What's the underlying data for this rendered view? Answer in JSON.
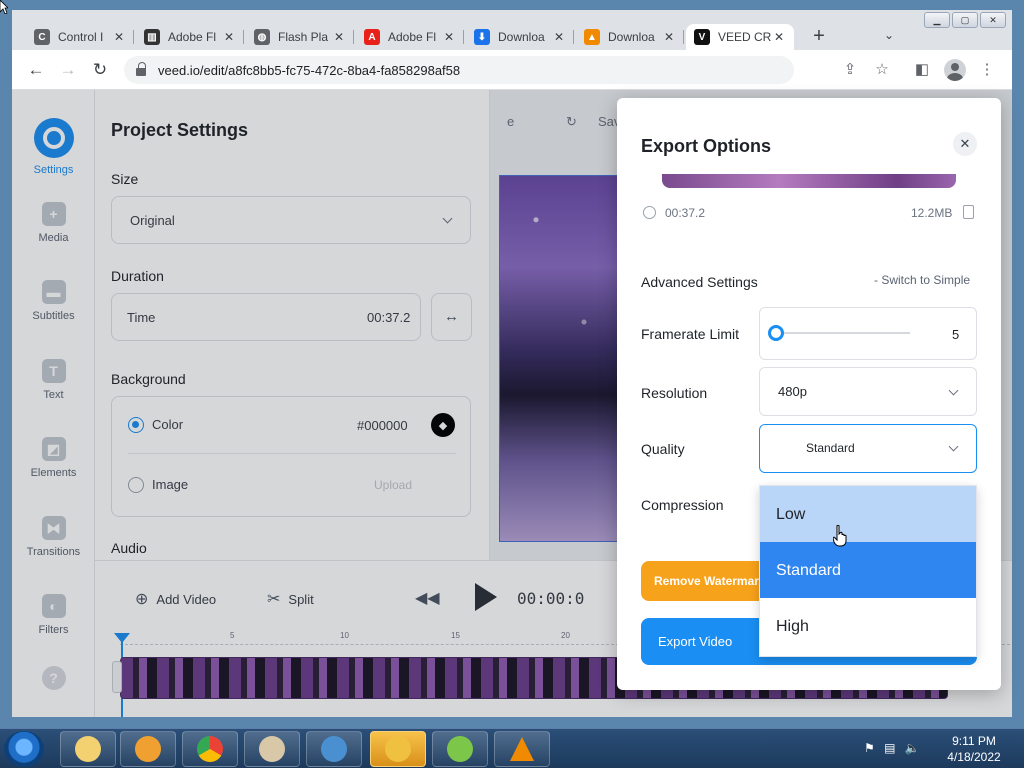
{
  "browser": {
    "tabs": [
      {
        "title": "Control I",
        "favicon": "C",
        "favicon_bg": "#5f6368",
        "favicon_name": "control-panel-icon"
      },
      {
        "title": "Adobe Fl",
        "favicon": "▥",
        "favicon_bg": "#333333",
        "favicon_name": "adobe-icon"
      },
      {
        "title": "Flash Pla",
        "favicon": "◍",
        "favicon_bg": "#5f6368",
        "favicon_name": "globe-icon"
      },
      {
        "title": "Adobe Fl",
        "favicon": "A",
        "favicon_bg": "#e8211b",
        "favicon_name": "adobe-red-icon"
      },
      {
        "title": "Downloa",
        "favicon": "⬇",
        "favicon_bg": "#1a73e8",
        "favicon_name": "download-icon"
      },
      {
        "title": "Downloa",
        "favicon": "▲",
        "favicon_bg": "#f08a00",
        "favicon_name": "vlc-icon"
      },
      {
        "title": "VEED CR",
        "favicon": "V",
        "favicon_bg": "#111111",
        "favicon_name": "veed-icon",
        "active": true
      }
    ],
    "url": "veed.io/edit/a8fc8bb5-fc75-472c-8ba4-fa858298af58"
  },
  "nav": {
    "items": [
      {
        "label": "Settings",
        "active": true
      },
      {
        "label": "Media",
        "glyph": "+"
      },
      {
        "label": "Subtitles",
        "glyph": "▬"
      },
      {
        "label": "Text",
        "glyph": "T"
      },
      {
        "label": "Elements",
        "glyph": "◩"
      },
      {
        "label": "Transitions",
        "glyph": "⧓"
      },
      {
        "label": "Filters",
        "glyph": "◐"
      },
      {
        "label": "",
        "glyph": "?"
      }
    ]
  },
  "project_settings": {
    "title": "Project Settings",
    "size_label": "Size",
    "size_value": "Original",
    "duration_label": "Duration",
    "time_label": "Time",
    "time_value": "00:37.2",
    "background_label": "Background",
    "color_label": "Color",
    "color_value": "#000000",
    "image_label": "Image",
    "upload_label": "Upload",
    "audio_label": "Audio"
  },
  "preview": {
    "left_text": "e",
    "save_text": "Sav"
  },
  "timeline": {
    "add_video": "Add Video",
    "split": "Split",
    "timecode": "00:00:0",
    "ticks": [
      "5",
      "10",
      "15",
      "20"
    ]
  },
  "export": {
    "title": "Export Options",
    "duration": "00:37.2",
    "filesize": "12.2MB",
    "advanced_label": "Advanced Settings",
    "switch_simple": "- Switch to Simple",
    "framerate_label": "Framerate Limit",
    "framerate_value": "5",
    "resolution_label": "Resolution",
    "resolution_value": "480p",
    "quality_label": "Quality",
    "quality_value": "Standard",
    "compression_label": "Compression",
    "remove_watermark": "Remove Watermark",
    "export_video": "Export Video",
    "quality_options": [
      {
        "label": "Low",
        "state": "hover"
      },
      {
        "label": "Standard",
        "state": "selected"
      },
      {
        "label": "High",
        "state": "normal"
      }
    ]
  },
  "taskbar": {
    "apps": [
      "explorer",
      "media-player",
      "chrome",
      "paint",
      "photo-viewer",
      "remote-desktop",
      "app-green",
      "vlc"
    ],
    "time": "9:11 PM",
    "date": "4/18/2022"
  },
  "colors": {
    "accent": "#1a8ef2",
    "watermark": "#f7a21b"
  }
}
